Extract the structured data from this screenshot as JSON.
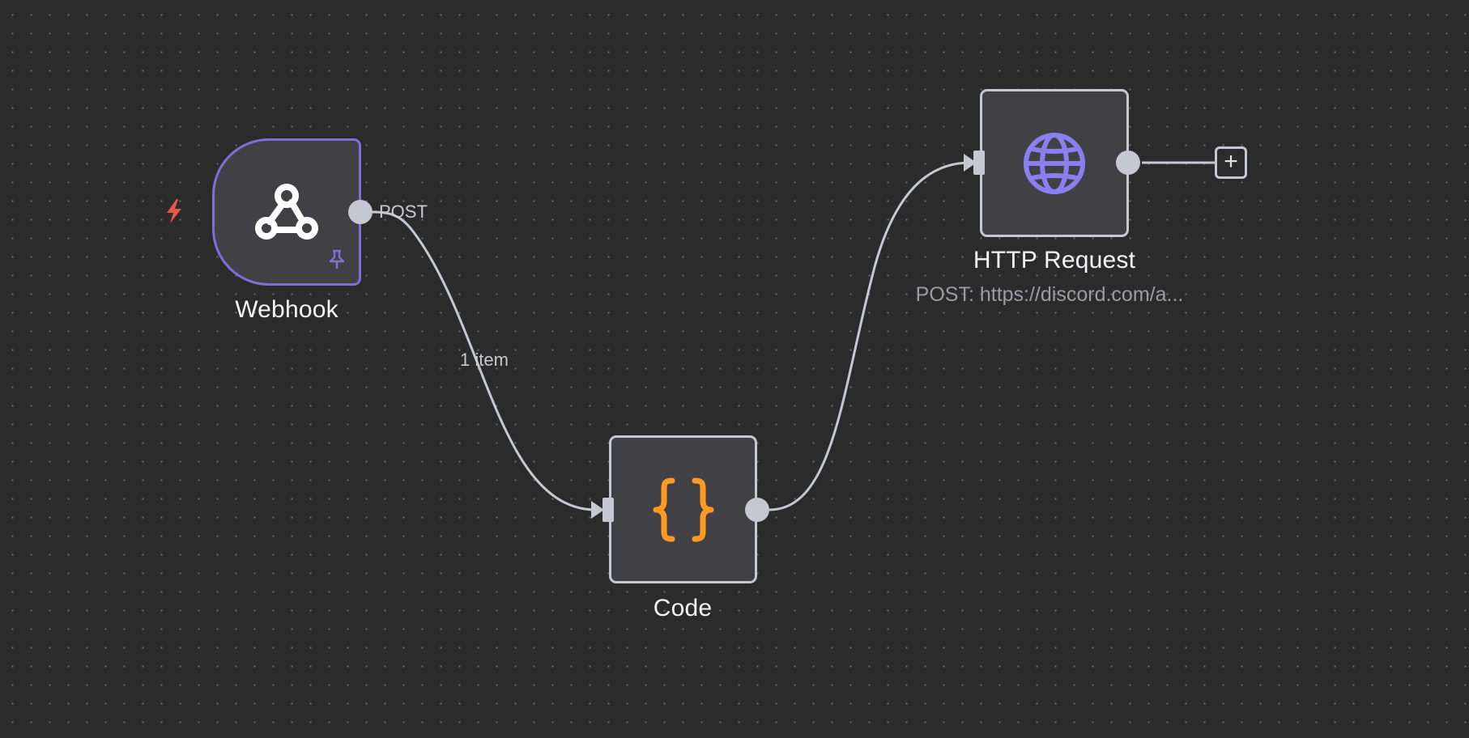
{
  "canvas": {
    "background": "#2b2b2c",
    "accent": "#7d6fd6",
    "node_border": "#c5c7d2"
  },
  "nodes": {
    "webhook": {
      "label": "Webhook",
      "icon": "webhook-icon",
      "output_label": "POST",
      "trigger_icon": "lightning-bolt-icon",
      "trigger_color": "#e8574a",
      "pinned_icon": "pin-icon"
    },
    "code": {
      "label": "Code",
      "icon": "curly-braces-icon",
      "icon_color": "#ff9922"
    },
    "http_request": {
      "label": "HTTP Request",
      "subtitle": "POST: https://discord.com/a...",
      "icon": "globe-icon",
      "icon_color": "#8b7ff0"
    }
  },
  "edges": [
    {
      "from": "webhook",
      "to": "code",
      "label": "1 item"
    },
    {
      "from": "code",
      "to": "http_request",
      "label": ""
    }
  ],
  "add_node_button": {
    "label": "+"
  }
}
